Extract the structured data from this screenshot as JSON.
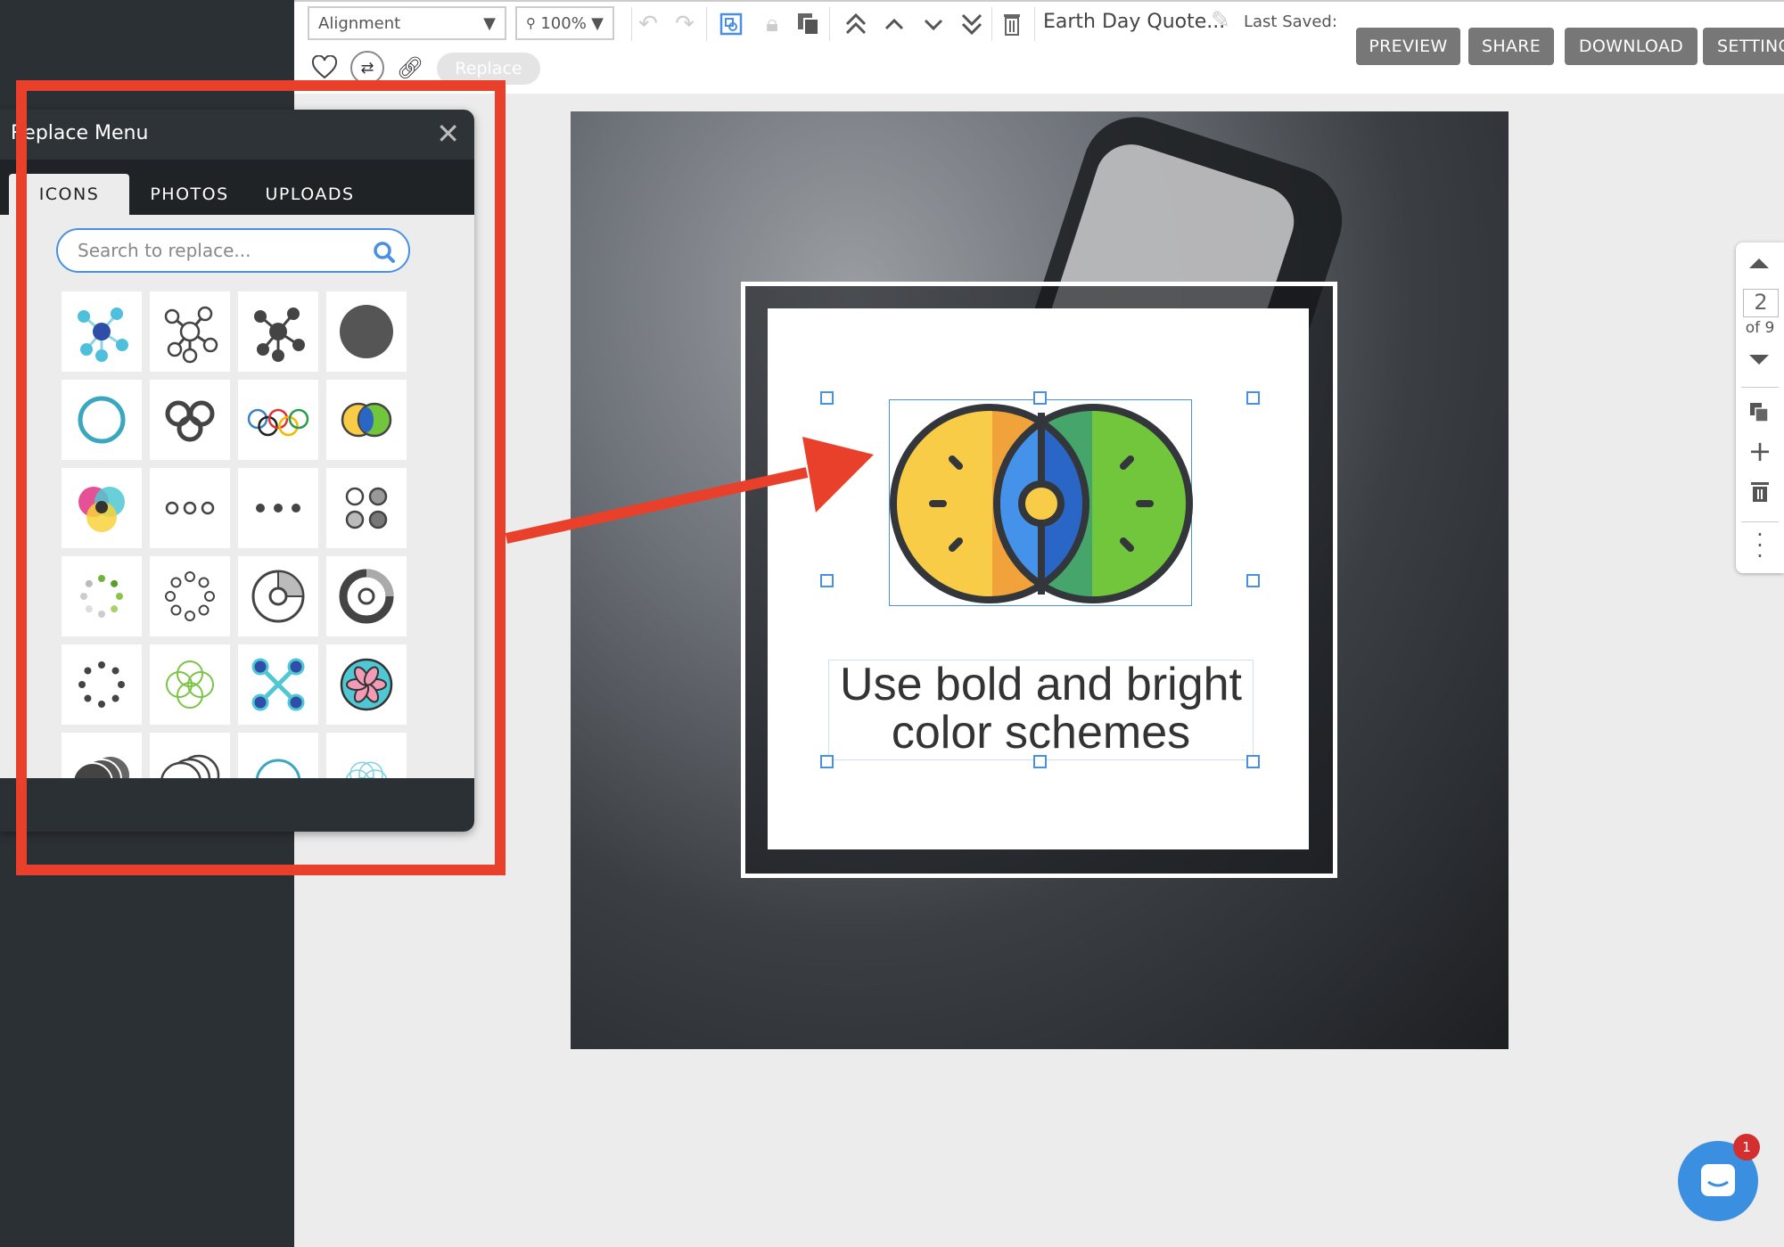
{
  "toolbar": {
    "alignment": "Alignment",
    "zoom": "100%",
    "doc_title": "Earth Day Quote...",
    "last_saved": "Last Saved:",
    "replace": "Replace",
    "buttons": {
      "preview": "PREVIEW",
      "share": "SHARE",
      "download": "DOWNLOAD",
      "settings": "SETTINGS"
    }
  },
  "replace_menu": {
    "title": "Replace Menu",
    "tabs": [
      {
        "label": "ICONS",
        "active": true
      },
      {
        "label": "PHOTOS"
      },
      {
        "label": "UPLOADS"
      }
    ],
    "search_placeholder": "Search to replace...",
    "icons": [
      "network-colored",
      "network-outline",
      "network-dark",
      "filled-circle",
      "ring",
      "three-rings",
      "olympic-rings",
      "venn-eye",
      "cmy-circles",
      "three-dots-outline",
      "three-dots",
      "circle-patterns",
      "dotted-spinner-green",
      "dotted-ring",
      "pie-chart-outline",
      "donut-chart",
      "dotted-spinner-dark",
      "green-flower",
      "molecule-x",
      "colored-flower",
      "stacked-circles-dark",
      "stacked-circles-outline",
      "ring-teal",
      "flower-outline"
    ]
  },
  "canvas": {
    "text": [
      "Use bold and bright",
      "color schemes"
    ]
  },
  "pager": {
    "current": "2",
    "of": "of 9"
  },
  "chat": {
    "badge": "1"
  },
  "colors": {
    "annotation": "#e8402a",
    "selection": "#4a90e2",
    "button": "#777777"
  }
}
